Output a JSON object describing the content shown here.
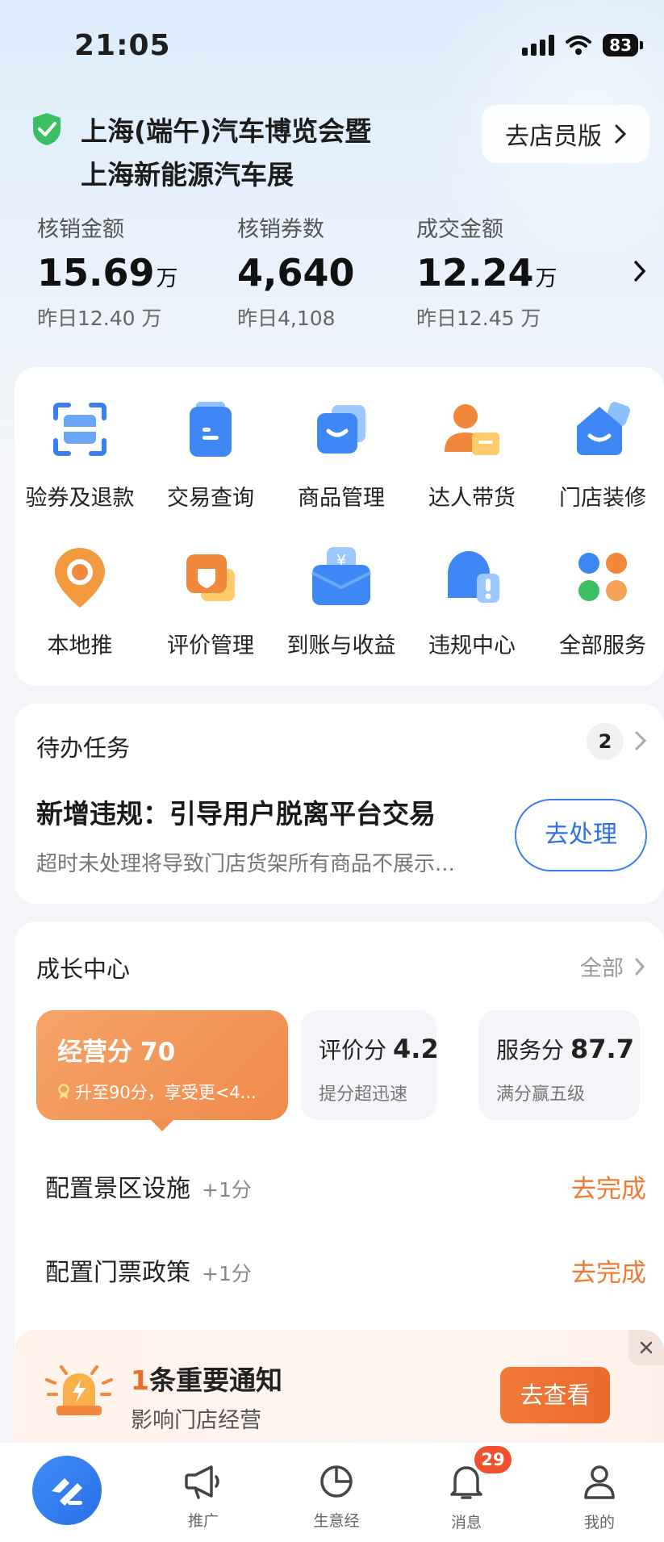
{
  "status_bar": {
    "time": "21:05",
    "battery": "83"
  },
  "header": {
    "shop_name_line1": "上海(端午)汽车博览会暨",
    "shop_name_line2": "上海新能源汽车展",
    "staff_button": "去店员版"
  },
  "metrics": [
    {
      "label": "核销金额",
      "value": "15.69",
      "unit": "万",
      "yesterday": "昨日12.40 万"
    },
    {
      "label": "核销券数",
      "value": "4,640",
      "unit": "",
      "yesterday": "昨日4,108"
    },
    {
      "label": "成交金额",
      "value": "12.24",
      "unit": "万",
      "yesterday": "昨日12.45 万"
    }
  ],
  "services": [
    {
      "label": "验券及退款",
      "icon": "scan-icon"
    },
    {
      "label": "交易查询",
      "icon": "document-icon"
    },
    {
      "label": "商品管理",
      "icon": "product-bag-icon"
    },
    {
      "label": "达人带货",
      "icon": "influencer-icon"
    },
    {
      "label": "门店装修",
      "icon": "store-decor-icon"
    },
    {
      "label": "本地推",
      "icon": "location-pin-icon"
    },
    {
      "label": "评价管理",
      "icon": "review-icon"
    },
    {
      "label": "到账与收益",
      "icon": "wallet-yen-icon"
    },
    {
      "label": "违规中心",
      "icon": "violation-bell-icon"
    },
    {
      "label": "全部服务",
      "icon": "all-services-icon"
    }
  ],
  "todo": {
    "title": "待办任务",
    "count": "2",
    "heading": "新增违规：引导用户脱离平台交易",
    "description": "超时未处理将导致门店货架所有商品不展示...",
    "button": "去处理"
  },
  "growth": {
    "title": "成长中心",
    "all_link": "全部",
    "main_score": {
      "label": "经营分",
      "value": "70",
      "hint": "升至90分，享受更<4..."
    },
    "scores": [
      {
        "label": "评价分",
        "value": "4.2",
        "sub": "提分超迅速"
      },
      {
        "label": "服务分",
        "value": "87.7",
        "sub": "满分赢五级"
      }
    ],
    "tasks": [
      {
        "name": "配置景区设施",
        "points": "+1分",
        "action": "去完成"
      },
      {
        "name": "配置门票政策",
        "points": "+1分",
        "action": "去完成"
      }
    ]
  },
  "notice": {
    "count": "1",
    "title_rest": "条重要通知",
    "subtitle": "影响门店经营",
    "button": "去查看"
  },
  "tabbar": {
    "items": [
      {
        "label": "推广",
        "icon": "megaphone-icon"
      },
      {
        "label": "生意经",
        "icon": "pie-chart-icon"
      },
      {
        "label": "消息",
        "icon": "bell-icon"
      },
      {
        "label": "我的",
        "icon": "person-icon"
      }
    ],
    "message_badge": "29"
  }
}
